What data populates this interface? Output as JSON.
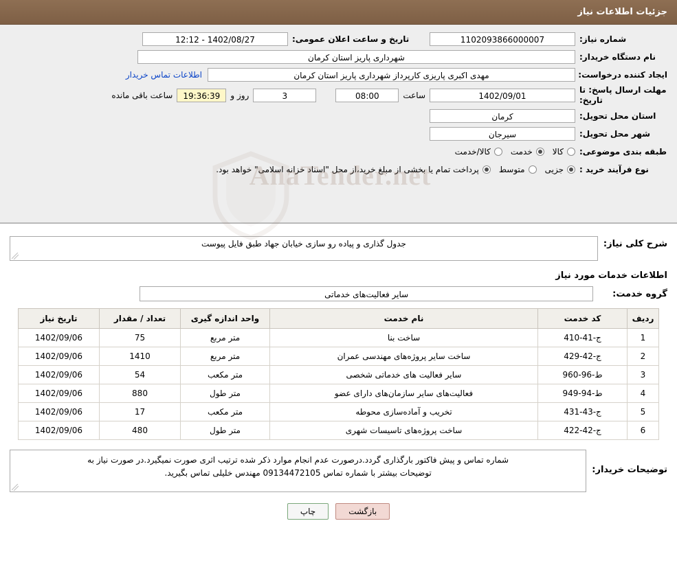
{
  "header": {
    "title": "جزئیات اطلاعات نیاز"
  },
  "info": {
    "need_number_label": "شماره نیاز:",
    "need_number_value": "1102093866000007",
    "announce_datetime_label": "تاریخ و ساعت اعلان عمومی:",
    "announce_datetime_value": "1402/08/27 - 12:12",
    "buyer_org_label": "نام دستگاه خریدار:",
    "buyer_org_value": "شهرداری پاریز استان کرمان",
    "requester_label": "ایجاد کننده درخواست:",
    "requester_value": "مهدی اکبری پاریزی کارپرداز شهرداری پاریز استان کرمان",
    "contact_link": "اطلاعات تماس خریدار",
    "deadline_label": "مهلت ارسال پاسخ: تا تاریخ:",
    "deadline_date": "1402/09/01",
    "hour_label": "ساعت",
    "hour_value": "08:00",
    "days_value": "3",
    "days_label": "روز و",
    "time_remaining": "19:36:39",
    "remaining_label": "ساعت باقی مانده",
    "province_label": "استان محل تحویل:",
    "province_value": "کرمان",
    "city_label": "شهر محل تحویل:",
    "city_value": "سیرجان",
    "category_label": "طبقه بندی موضوعی:",
    "category_options": [
      "کالا",
      "خدمت",
      "کالا/خدمت"
    ],
    "category_selected": "خدمت",
    "process_label": "نوع فرآیند خرید :",
    "process_options": [
      "جزیی",
      "متوسط"
    ],
    "process_selected": "جزیی",
    "process_note": "پرداخت تمام یا بخشی از مبلغ خرید،از محل \"اسناد خزانه اسلامی\" خواهد بود."
  },
  "watermark": {
    "text": "AnaTender.net"
  },
  "need": {
    "summary_label": "شرح کلی نیاز:",
    "summary_value": "جدول گذاری و پیاده رو سازی خیابان جهاد طبق فایل پیوست",
    "services_title": "اطلاعات خدمات مورد نیاز",
    "group_label": "گروه خدمت:",
    "group_value": "سایر فعالیت‌های خدماتی"
  },
  "table": {
    "columns": [
      "ردیف",
      "کد خدمت",
      "نام خدمت",
      "واحد اندازه گیری",
      "تعداد / مقدار",
      "تاریخ نیاز"
    ],
    "rows": [
      [
        "1",
        "ج-41-410",
        "ساخت بنا",
        "متر مربع",
        "75",
        "1402/09/06"
      ],
      [
        "2",
        "ج-42-429",
        "ساخت سایر پروژه‌های مهندسی عمران",
        "متر مربع",
        "1410",
        "1402/09/06"
      ],
      [
        "3",
        "ط-96-960",
        "سایر فعالیت های خدماتی شخصی",
        "متر مکعب",
        "54",
        "1402/09/06"
      ],
      [
        "4",
        "ط-94-949",
        "فعالیت‌های سایر سازمان‌های دارای عضو",
        "متر طول",
        "880",
        "1402/09/06"
      ],
      [
        "5",
        "ج-43-431",
        "تخریب و آماده‌سازی محوطه",
        "متر مکعب",
        "17",
        "1402/09/06"
      ],
      [
        "6",
        "ج-42-422",
        "ساخت پروژه‌های تاسیسات شهری",
        "متر طول",
        "480",
        "1402/09/06"
      ]
    ]
  },
  "notes": {
    "label": "توضیحات خریدار:",
    "line1": "شماره تماس و پیش فاکتور بارگذاری گردد.درصورت عدم انجام موارد ذکر شده ترتیب اثری صورت نمیگیرد.در صورت نیاز به",
    "line2": "توضیحات بیشتر با شماره تماس 09134472105 مهندس خلیلی تماس بگیرید."
  },
  "footer": {
    "print_label": "چاپ",
    "back_label": "بازگشت"
  }
}
